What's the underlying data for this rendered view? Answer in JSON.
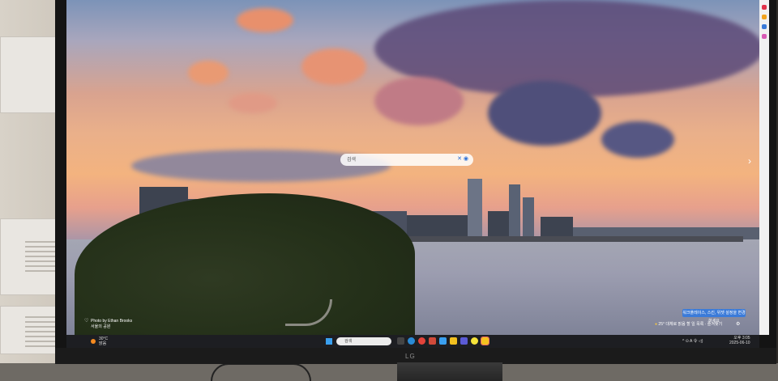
{
  "screen": {
    "search_placeholder": "검색",
    "next_arrow": "›",
    "photo_credit": "Photo by Ethan Brooks",
    "photo_location": "서울의 공원",
    "notice_text": "워크플레이스, 스킨, 위젯 설정을 변경하세요",
    "weather": "25° 대체로 맑음",
    "weather_feed": "할 일 목록 · 즐겨찾기"
  },
  "taskbar": {
    "weather_temp": "30°C",
    "weather_desc": "맑음",
    "search_placeholder": "검색",
    "tray_text": "^ ⊙ A 令 ◁)",
    "time": "오후 3:05",
    "date": "2025-06-10"
  },
  "monitor": {
    "brand": "LG"
  },
  "colors": {
    "accent": "#3b7bd9",
    "taskbar_bg": "#1d1e22",
    "sunset_orange": "#f3b37f"
  },
  "icons": [
    "search-icon",
    "close-icon",
    "mic-icon",
    "chevron-right-icon",
    "windows-icon",
    "settings-icon",
    "heart-icon"
  ]
}
